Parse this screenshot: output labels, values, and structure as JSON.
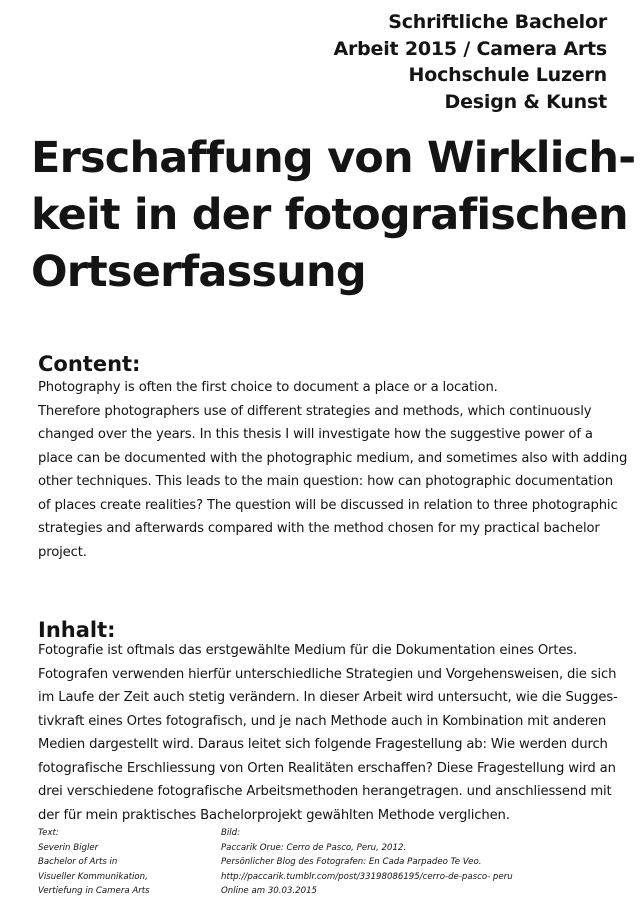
{
  "header": {
    "lines": [
      "Schriftliche Bachelor",
      "Arbeit 2015 / Camera Arts",
      "Hochschule Luzern",
      "Design & Kunst"
    ]
  },
  "title": {
    "lines": [
      "Erschaffung von Wirklich-",
      "keit in der fotografischen",
      "Ortserfassung"
    ]
  },
  "content": {
    "heading": "Content:",
    "lines": [
      "Photography is often the first choice to document a place or a location.",
      "Therefore photographers use of different strategies and methods, which continuously",
      "changed over the years. In this thesis I will investigate how the suggestive power of a",
      "place can be documented with the photographic medium, and sometimes also with adding",
      "other techniques. This leads to the main question: how can photographic documentation",
      "of places create realities? The question will be discussed in relation to three photographic",
      "strategies and afterwards compared with the method chosen for my practical bachelor",
      "project."
    ]
  },
  "inhalt": {
    "heading": "Inhalt:",
    "lines": [
      "Fotografie ist oftmals das erstgewählte Medium für die Dokumentation eines Ortes.",
      "Fotografen verwenden hierfür unterschiedliche Strategien und Vorgehensweisen, die sich",
      "im Laufe der Zeit auch stetig verändern. In dieser Arbeit wird untersucht, wie die Sugges-",
      "tivkraft eines Ortes fotografisch, und je nach Methode auch in Kombination mit anderen",
      "Medien dargestellt wird. Daraus leitet sich folgende Fragestellung ab: Wie werden durch",
      "fotografische Erschliessung von Orten Realitäten erschaffen? Diese Fragestellung wird an",
      "drei verschiedene fotografische Arbeitsmethoden herangetragen. und anschliessend mit",
      "der für mein praktisches Bachelorprojekt gewählten Methode verglichen."
    ]
  },
  "footer": {
    "text_col": [
      "Text:",
      "Severin Bigler",
      "Bachelor of Arts in",
      "Visueller Kommunikation,",
      "Vertiefung in Camera Arts"
    ],
    "image_col": [
      "Bild:",
      "Paccarik Orue: Cerro de Pasco, Peru, 2012.",
      "Persönlicher Blog des Fotografen: En Cada Parpadeo Te Veo.",
      "http://paccarik.tumblr.com/post/33198086195/cerro-de-pasco- peru",
      "Online am 30.03.2015"
    ]
  }
}
